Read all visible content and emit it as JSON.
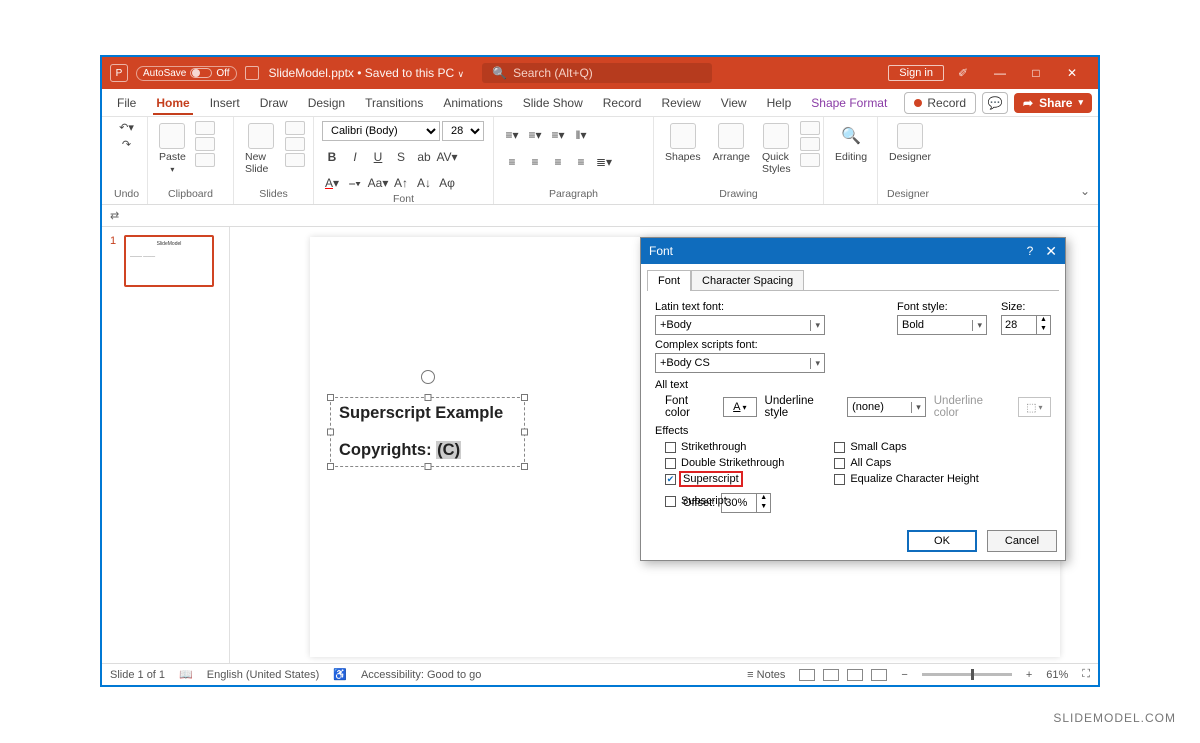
{
  "titlebar": {
    "autosave_label": "AutoSave",
    "autosave_state": "Off",
    "doc_name": "SlideModel.pptx",
    "saved_state": "Saved to this PC",
    "search_placeholder": "Search (Alt+Q)",
    "signin": "Sign in"
  },
  "tabs": [
    "File",
    "Home",
    "Insert",
    "Draw",
    "Design",
    "Transitions",
    "Animations",
    "Slide Show",
    "Record",
    "Review",
    "View",
    "Help"
  ],
  "context_tab": "Shape Format",
  "active_tab": "Home",
  "ribbon_right": {
    "record": "Record",
    "share": "Share"
  },
  "ribbon": {
    "groups": {
      "undo": "Undo",
      "clipboard": "Clipboard",
      "paste": "Paste",
      "slides": "Slides",
      "new_slide": "New Slide",
      "font": "Font",
      "font_name": "Calibri (Body)",
      "font_size": "28",
      "paragraph": "Paragraph",
      "drawing": "Drawing",
      "shapes": "Shapes",
      "arrange": "Arrange",
      "quick_styles": "Quick Styles",
      "editing": "Editing",
      "designer": "Designer"
    }
  },
  "thumb": {
    "number": "1",
    "title": "SlideModel"
  },
  "slide": {
    "heading": "Superscript Example",
    "line_pre": "Copyrights: ",
    "line_sel": "(C)"
  },
  "dialog": {
    "title": "Font",
    "tabs": [
      "Font",
      "Character Spacing"
    ],
    "latin_label": "Latin text font:",
    "latin_value": "+Body",
    "style_label": "Font style:",
    "style_value": "Bold",
    "size_label": "Size:",
    "size_value": "28",
    "complex_label": "Complex scripts font:",
    "complex_value": "+Body CS",
    "alltext_label": "All text",
    "fontcolor_label": "Font color",
    "underline_label": "Underline style",
    "underline_value": "(none)",
    "underlinecolor_label": "Underline color",
    "effects_label": "Effects",
    "strikethrough": "Strikethrough",
    "double_strike": "Double Strikethrough",
    "superscript": "Superscript",
    "subscript": "Subscript",
    "offset_label": "Offset:",
    "offset_value": "30%",
    "small_caps": "Small Caps",
    "all_caps": "All Caps",
    "equalize": "Equalize Character Height",
    "ok": "OK",
    "cancel": "Cancel"
  },
  "status": {
    "slide": "Slide 1 of 1",
    "lang": "English (United States)",
    "access": "Accessibility: Good to go",
    "notes": "Notes",
    "zoom": "61%"
  },
  "watermark": "SLIDEMODEL.COM"
}
